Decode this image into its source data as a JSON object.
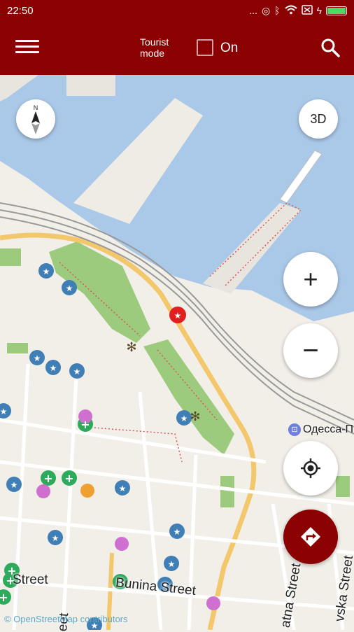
{
  "status_bar": {
    "time": "22:50",
    "signal_dots": "...",
    "colors": {
      "battery": "#4cd964"
    }
  },
  "app_bar": {
    "menu_icon": "hamburger-menu-icon",
    "tourist_mode_label_line1": "Tourist",
    "tourist_mode_label_line2": "mode",
    "tourist_toggle_checked": false,
    "tourist_toggle_label": "On",
    "search_icon": "search-icon",
    "background_color": "#8b0000"
  },
  "map": {
    "colors": {
      "water": "#aac8e8",
      "land": "#f2efe9",
      "park": "#9ccb7d",
      "major_road": "#f3c76b",
      "rail": "#999999",
      "poi_star": "#3f7fb5",
      "poi_cross": "#2eaa5c",
      "poi_shop": "#cf6fcf",
      "poi_food": "#f0a030"
    },
    "station_name": "Одесса-П",
    "streets": {
      "bunina": "Bunina Street",
      "street_left": "Street",
      "street_bottom_center": "eet",
      "atna": "atna Street",
      "vska": "vska Street"
    },
    "attribution": "© OpenStreetMap contributors"
  },
  "controls": {
    "compass_letter": "N",
    "btn_3d": "3D",
    "zoom_in": "+",
    "zoom_out": "−",
    "locate_icon": "my-location-icon",
    "route_icon": "directions-icon"
  }
}
